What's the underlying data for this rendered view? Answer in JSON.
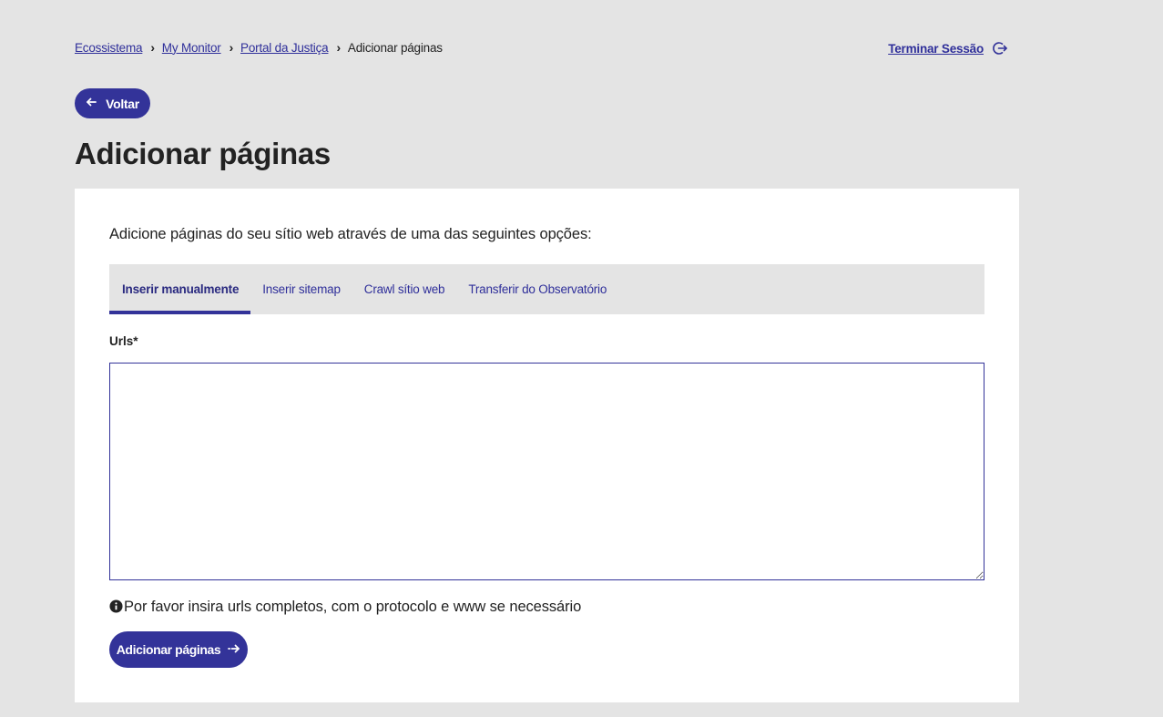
{
  "breadcrumb": {
    "items": [
      "Ecossistema",
      "My Monitor",
      "Portal da Justiça"
    ],
    "current": "Adicionar páginas"
  },
  "header": {
    "logout_label": "Terminar Sessão",
    "logout_icon": "logout-icon"
  },
  "back_button": {
    "label": "Voltar",
    "icon": "arrow-left-icon"
  },
  "page": {
    "title": "Adicionar páginas"
  },
  "form": {
    "intro": "Adicione páginas do seu sítio web através de uma das seguintes opções:",
    "tabs": [
      {
        "label": "Inserir manualmente",
        "active": true
      },
      {
        "label": "Inserir sitemap",
        "active": false
      },
      {
        "label": "Crawl sítio web",
        "active": false
      },
      {
        "label": "Transferir do Observatório",
        "active": false
      }
    ],
    "urls_label": "Urls*",
    "urls_value": "",
    "hint": "Por favor insira urls completos, com o protocolo e www se necessário",
    "hint_icon": "info-icon",
    "submit_label": "Adicionar páginas",
    "submit_icon": "arrow-right-icon"
  },
  "colors": {
    "background": "#e4e4e4",
    "card": "#ffffff",
    "accent": "#333399",
    "link": "#2f2f9a",
    "text": "#222222"
  }
}
